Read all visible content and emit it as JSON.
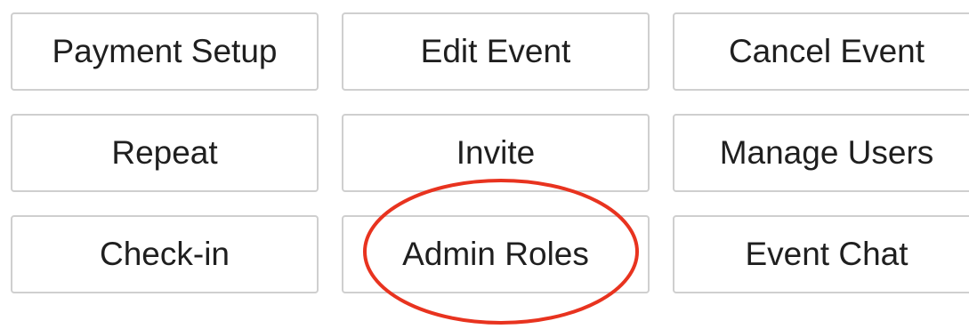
{
  "buttons": [
    {
      "label": "Payment Setup"
    },
    {
      "label": "Edit Event"
    },
    {
      "label": "Cancel Event"
    },
    {
      "label": "Repeat"
    },
    {
      "label": "Invite"
    },
    {
      "label": "Manage Users"
    },
    {
      "label": "Check-in"
    },
    {
      "label": "Admin Roles"
    },
    {
      "label": "Event Chat"
    }
  ],
  "annotation": {
    "shape": "ellipse",
    "color": "#e8331f",
    "target": "Admin Roles"
  }
}
